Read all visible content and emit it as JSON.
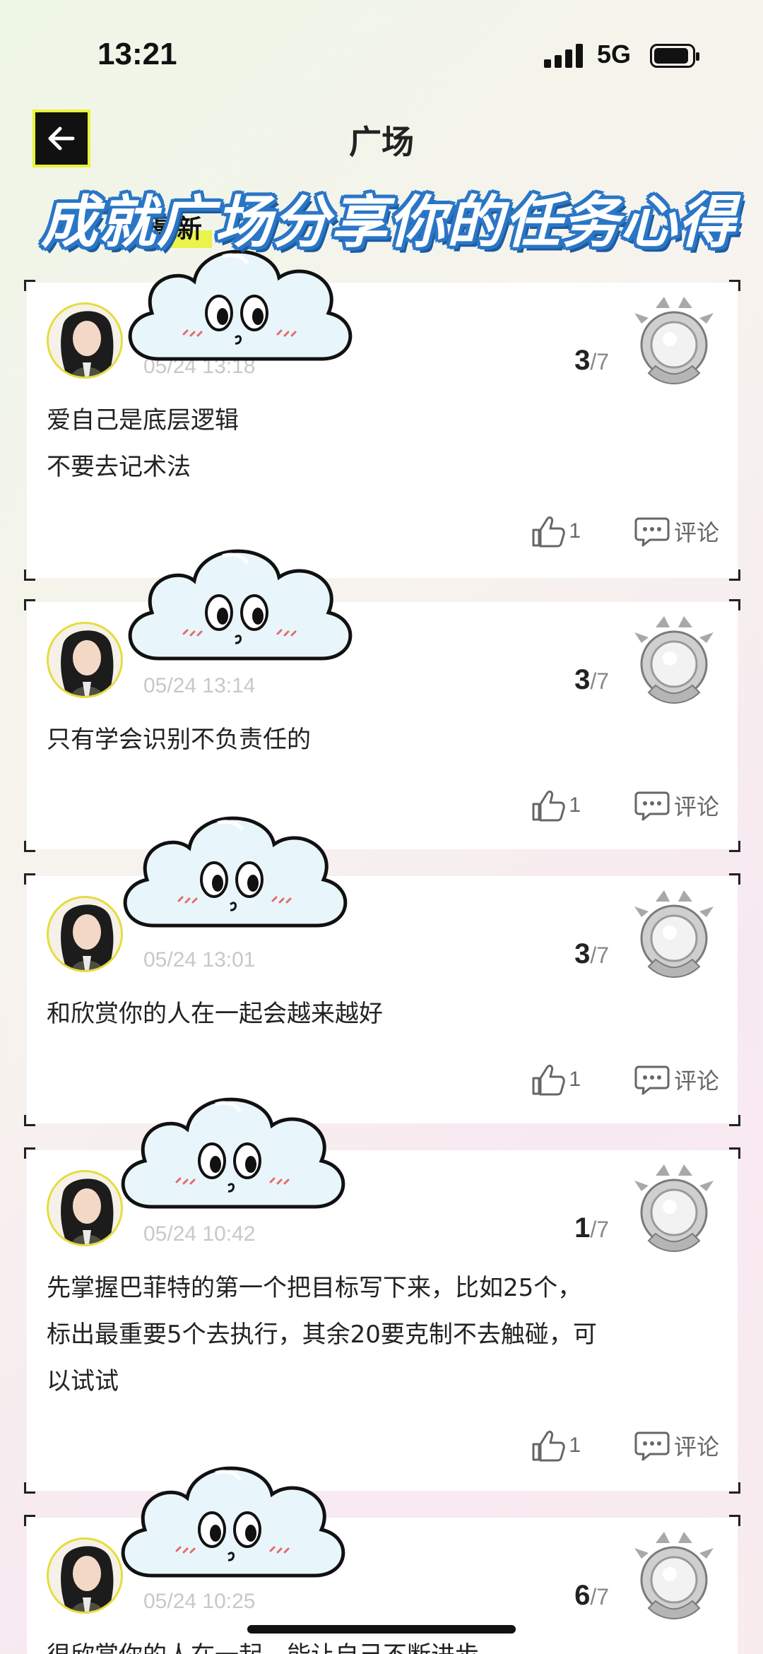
{
  "status": {
    "time": "13:21",
    "network": "5G"
  },
  "header": {
    "title": "广场"
  },
  "tabs": {
    "latest": "最新",
    "other": ""
  },
  "banner": "成就广场分享你的任务心得",
  "posts": [
    {
      "time": "05/24 13:18",
      "progress": "3",
      "total": "/7",
      "lines": [
        "爱自己是底层逻辑",
        "不要去记术法"
      ],
      "likes": "1",
      "comment_label": "评论"
    },
    {
      "time": "05/24 13:14",
      "progress": "3",
      "total": "/7",
      "lines": [
        "只有学会识别不负责任的"
      ],
      "likes": "1",
      "comment_label": "评论"
    },
    {
      "time": "05/24 13:01",
      "progress": "3",
      "total": "/7",
      "lines": [
        "和欣赏你的人在一起会越来越好"
      ],
      "likes": "1",
      "comment_label": "评论"
    },
    {
      "time": "05/24 10:42",
      "progress": "1",
      "total": "/7",
      "lines": [
        "先掌握巴菲特的第一个把目标写下来，比如25个，",
        "标出最重要5个去执行，其余20要克制不去触碰，可",
        "以试试"
      ],
      "likes": "1",
      "comment_label": "评论"
    },
    {
      "time": "05/24 10:25",
      "progress": "6",
      "total": "/7",
      "lines": [
        "很欣赏你的人在一起，能让自己不断进步"
      ],
      "likes": "",
      "comment_label": ""
    }
  ],
  "colors": {
    "accent": "#e9f34a",
    "banner_outline": "#2a76c6",
    "cloud": "#e8f6fb"
  }
}
